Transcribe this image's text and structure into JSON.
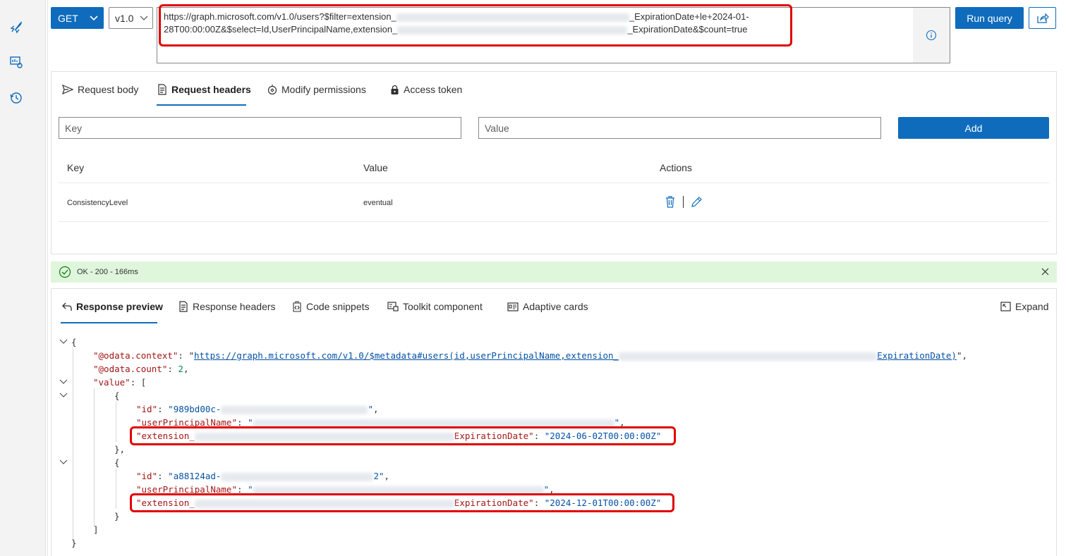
{
  "toolbar": {
    "method": "GET",
    "version": "v1.0",
    "url_line1_prefix": "https://graph.microsoft.com/v1.0/users?$filter=extension_",
    "url_line1_suffix": "_ExpirationDate+le+2024-01-",
    "url_line2_prefix": "28T00:00:00Z&$select=Id,UserPrincipalName,extension_",
    "url_line2_suffix": "_ExpirationDate&$count=true",
    "run_label": "Run query"
  },
  "request_tabs": [
    "Request body",
    "Request headers",
    "Modify permissions",
    "Access token"
  ],
  "request_headers": {
    "key_placeholder": "Key",
    "value_placeholder": "Value",
    "add_label": "Add",
    "columns": [
      "Key",
      "Value",
      "Actions"
    ],
    "rows": [
      {
        "key": "ConsistencyLevel",
        "value": "eventual"
      }
    ]
  },
  "status": {
    "text": "OK - 200 - 166ms",
    "color": "#dff6dd"
  },
  "response_tabs": [
    "Response preview",
    "Response headers",
    "Code snippets",
    "Toolkit component",
    "Adaptive cards"
  ],
  "expand_label": "Expand",
  "response": {
    "context_key": "\"@odata.context\"",
    "context_prefix": "https://graph.microsoft.com/v1.0/$metadata#users(id,userPrincipalName,extension_",
    "context_suffix": "ExpirationDate)",
    "count_key": "\"@odata.count\"",
    "count_value": "2",
    "value_key": "\"value\"",
    "items": [
      {
        "id_key": "\"id\"",
        "id_prefix": "\"989bd00c-",
        "upn_key": "\"userPrincipalName\"",
        "ext_key_prefix": "\"extension_",
        "ext_key_suffix": "ExpirationDate\"",
        "ext_value": "\"2024-06-02T00:00:00Z\""
      },
      {
        "id_key": "\"id\"",
        "id_prefix": "\"a88124ad-",
        "id_suffix": "2\"",
        "upn_key": "\"userPrincipalName\"",
        "ext_key_prefix": "\"extension_",
        "ext_key_suffix": "ExpirationDate\"",
        "ext_value": "\"2024-12-01T00:00:00Z\""
      }
    ]
  },
  "colors": {
    "accent": "#0f6cbd",
    "highlight": "#e00000",
    "json_key": "#a31515",
    "json_string": "#0451a5",
    "json_number": "#098658"
  }
}
